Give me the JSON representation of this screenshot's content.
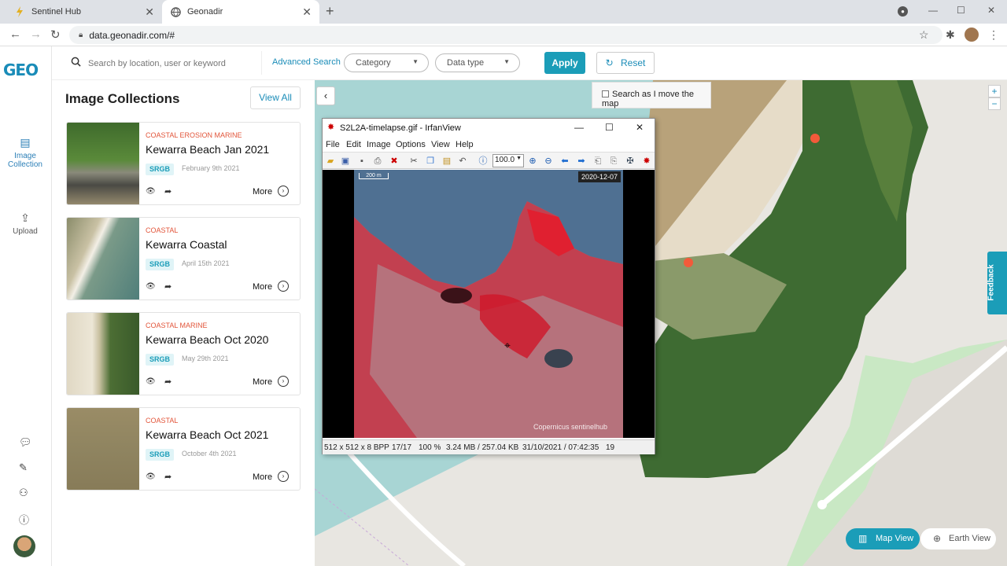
{
  "browser": {
    "tabs": [
      {
        "title": "Sentinel Hub",
        "active": false
      },
      {
        "title": "Geonadir",
        "active": true
      }
    ],
    "url": "data.geonadir.com/#"
  },
  "app": {
    "logo": "GEO",
    "nav": {
      "image_collection": "Image Collection",
      "upload": "Upload"
    },
    "search": {
      "placeholder": "Search by location, user or keyword",
      "advanced": "Advanced Search",
      "category": "Category",
      "datatype": "Data type",
      "apply": "Apply",
      "reset": "Reset"
    },
    "panel": {
      "title": "Image Collections",
      "view_all": "View All",
      "more": "More",
      "cards": [
        {
          "tags": "COASTAL EROSION MARINE",
          "title": "Kewarra Beach Jan 2021",
          "badge": "SRGB",
          "date": "February 9th 2021"
        },
        {
          "tags": "COASTAL",
          "title": "Kewarra Coastal",
          "badge": "SRGB",
          "date": "April 15th 2021"
        },
        {
          "tags": "COASTAL MARINE",
          "title": "Kewarra Beach Oct 2020",
          "badge": "SRGB",
          "date": "May 29th 2021"
        },
        {
          "tags": "COASTAL",
          "title": "Kewarra Beach Oct 2021",
          "badge": "SRGB",
          "date": "October 4th 2021"
        }
      ]
    },
    "map": {
      "search_move": "Search as I move the map",
      "feedback": "Feedback",
      "map_view": "Map View",
      "earth_view": "Earth View"
    }
  },
  "irfanview": {
    "title": "S2L2A-timelapse.gif - IrfanView",
    "menu": [
      "File",
      "Edit",
      "Image",
      "Options",
      "View",
      "Help"
    ],
    "zoom": "100.0",
    "image_date": "2020-12-07",
    "scale": "200 m",
    "watermark": "Copernicus  sentinelhub",
    "status": {
      "dims": "512 x 512 x 8 BPP",
      "frame": "17/17",
      "zoom": "100 %",
      "size": "3.24 MB / 257.04 KB",
      "datetime": "31/10/2021 / 07:42:35",
      "extra": "19"
    }
  }
}
